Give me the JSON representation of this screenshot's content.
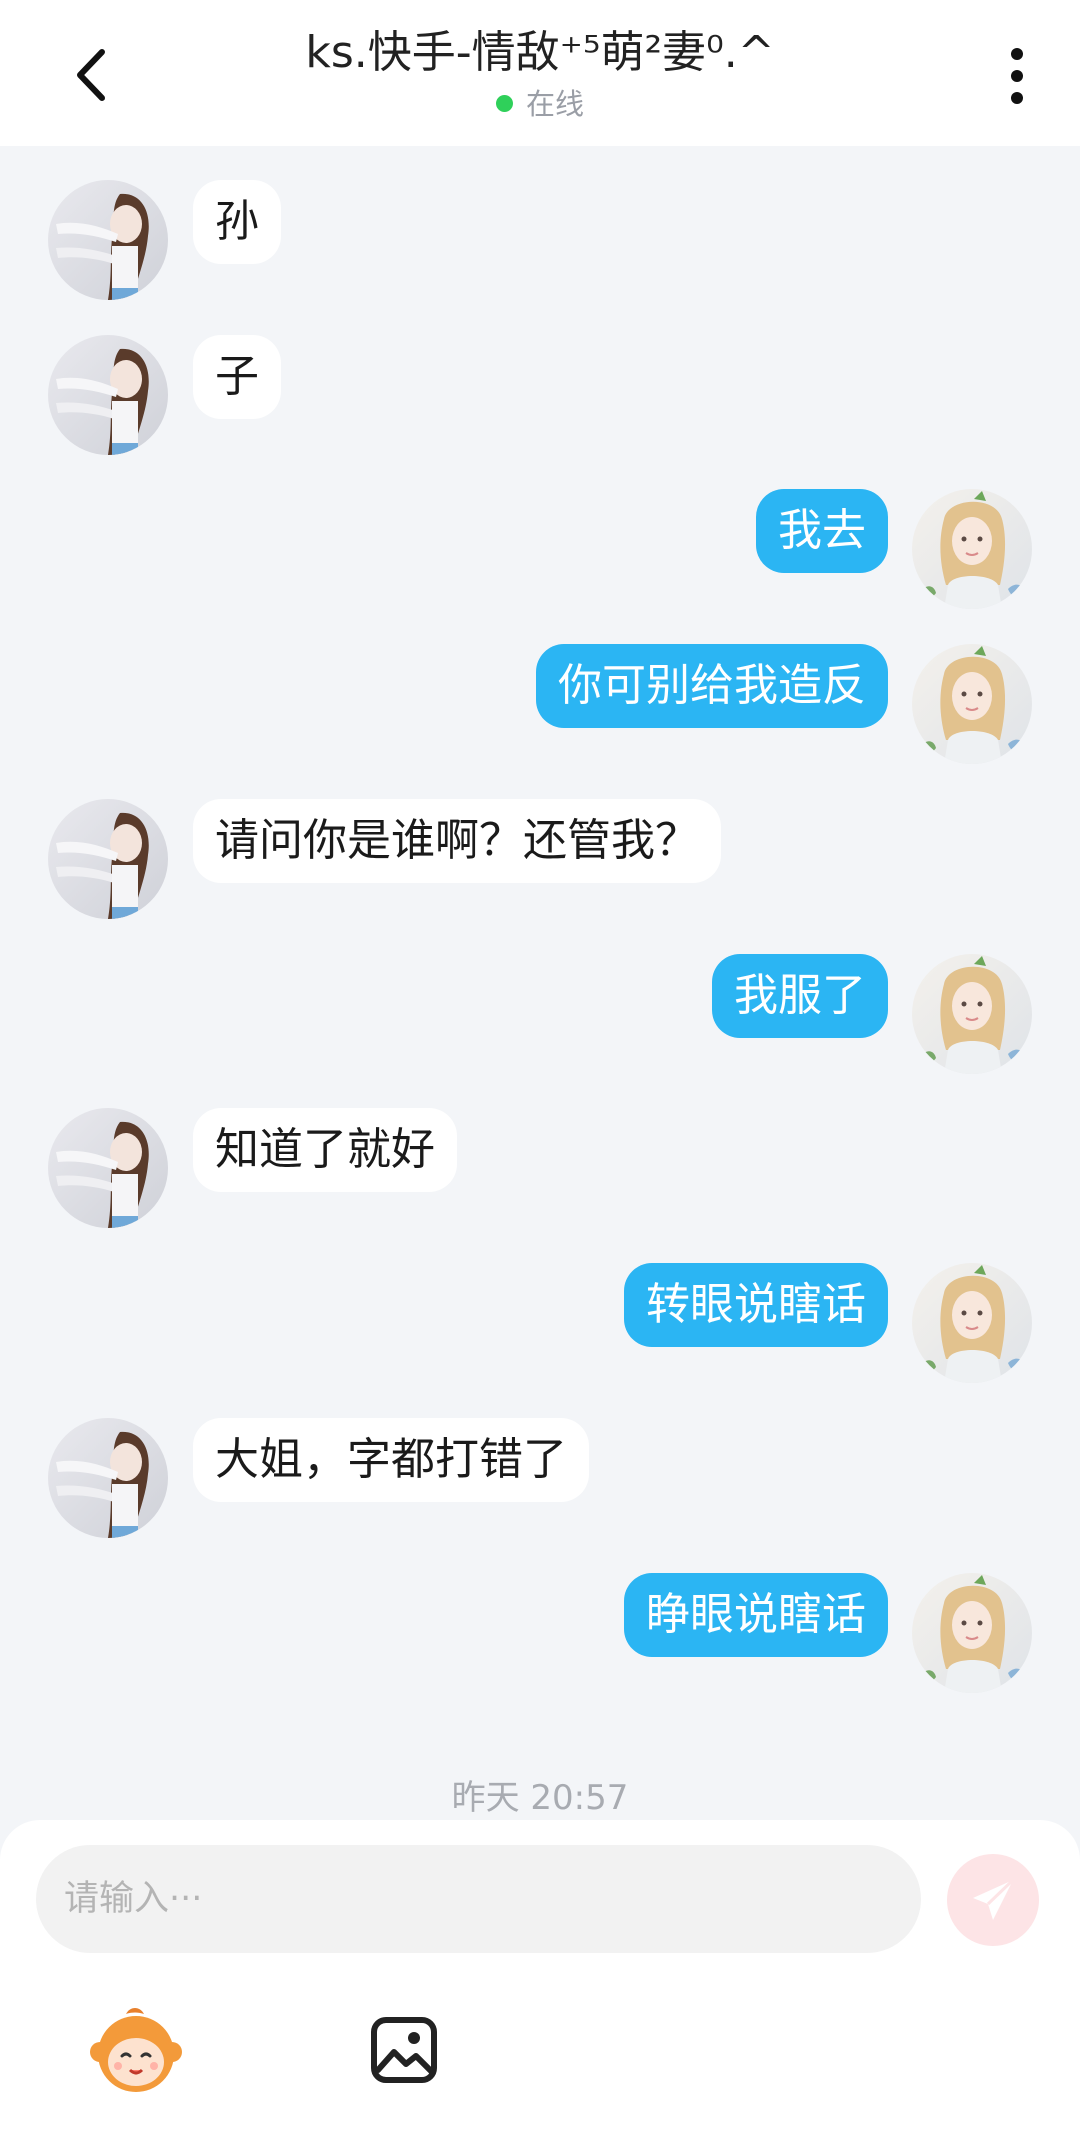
{
  "header": {
    "title": "ks.快手-情敌⁺⁵萌²妻⁰.^",
    "status": "在线",
    "status_color": "#2fd05a"
  },
  "messages": [
    {
      "side": "left",
      "text": "孙"
    },
    {
      "side": "left",
      "text": "子"
    },
    {
      "side": "right",
      "text": "我去"
    },
    {
      "side": "right",
      "text": "你可别给我造反"
    },
    {
      "side": "left",
      "text": "请问你是谁啊？还管我？"
    },
    {
      "side": "right",
      "text": "我服了"
    },
    {
      "side": "left",
      "text": "知道了就好"
    },
    {
      "side": "right",
      "text": "转眼说瞎话"
    },
    {
      "side": "left",
      "text": "大姐，字都打错了"
    },
    {
      "side": "right",
      "text": "睁眼说瞎话"
    }
  ],
  "timestamp": "昨天 20:57",
  "composer": {
    "placeholder": "请输入···",
    "value": ""
  },
  "icons": {
    "back": "chevron-left-icon",
    "more": "more-vertical-icon",
    "send": "paper-plane-icon",
    "sticker": "monkey-face-icon",
    "image": "image-icon"
  },
  "colors": {
    "own_bubble": "#2bb5f3",
    "other_bubble": "#ffffff",
    "background": "#f3f5f8",
    "send_button": "#fde4e6"
  }
}
